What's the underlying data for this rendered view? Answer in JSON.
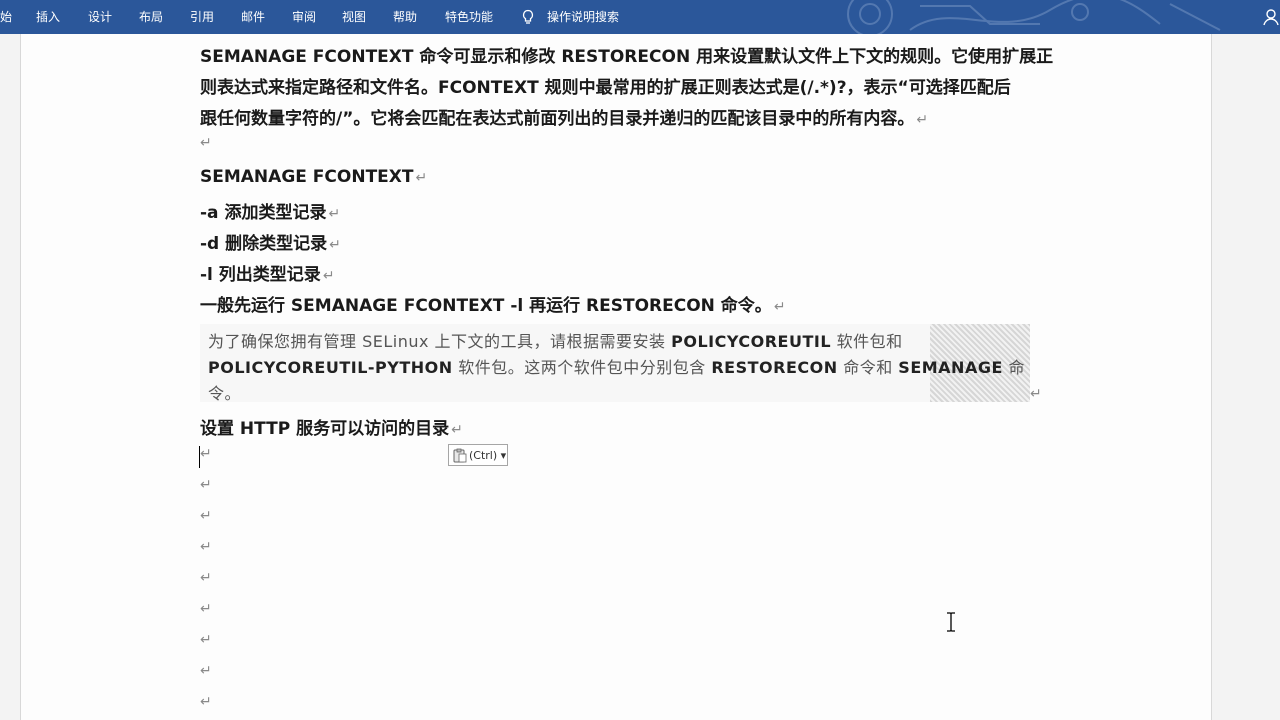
{
  "ribbon": {
    "tabs": [
      "始",
      "插入",
      "设计",
      "布局",
      "引用",
      "邮件",
      "审阅",
      "视图",
      "帮助",
      "特色功能"
    ],
    "search_label": "操作说明搜索"
  },
  "doc": {
    "para1": [
      "SEMANAGE   FCONTEXT 命令可显示和修改 RESTORECON 用来设置默认文件上下文的规则。它使用扩展正",
      "则表达式来指定路径和文件名。FCONTEXT 规则中最常用的扩展正则表达式是(/.*)?，表示“可选择匹配后",
      "跟任何数量字符的/”。它将会匹配在表达式前面列出的目录并递归的匹配该目录中的所有内容。"
    ],
    "cmd_title": "SEMANAGE FCONTEXT",
    "opt_a": "-a  添加类型记录",
    "opt_d": "-d  删除类型记录",
    "opt_l": "-l  列出类型记录",
    "run_line": "一般先运行 SEMANAGE FCONTEXT -l  再运行 RESTORECON 命令。",
    "quote": {
      "l1a": "为了确保您拥有管理 SELinux 上下文的工具，请根据需要安装 ",
      "l1b": "POLICYCOREUTIL",
      "l1c": " 软件包和",
      "l2a": "POLICYCOREUTIL-PYTHON",
      "l2b": " 软件包。这两个软件包中分别包含 ",
      "l2c": "RESTORECON",
      "l2d": " 命令和 ",
      "l2e": "SEMANAGE",
      "l2f": " 命",
      "l3": "令。"
    },
    "section_title": "设置 HTTP 服务可以访问的目录",
    "para_mark": "↵"
  },
  "paste_options": {
    "label": "(Ctrl)",
    "arrow": "▾"
  }
}
